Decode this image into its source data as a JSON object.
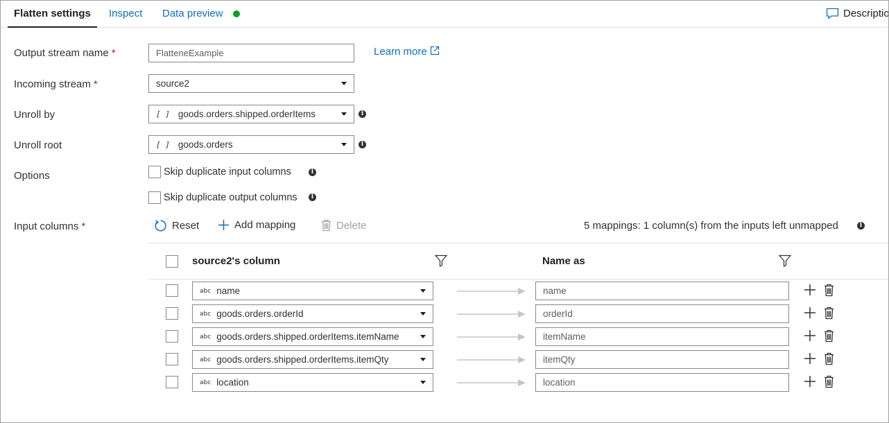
{
  "tabs": [
    {
      "label": "Flatten settings"
    },
    {
      "label": "Inspect"
    },
    {
      "label": "Data preview"
    }
  ],
  "description_label": "Description",
  "form": {
    "output_stream": {
      "label": "Output stream name",
      "required": "*",
      "value": "FlatteneExample"
    },
    "learn_more": "Learn more",
    "incoming_stream": {
      "label": "Incoming stream",
      "required": "*",
      "value": "source2"
    },
    "unroll_by": {
      "label": "Unroll by",
      "prefix": "[ ]",
      "value": "goods.orders.shipped.orderItems"
    },
    "unroll_root": {
      "label": "Unroll root",
      "prefix": "[ ]",
      "value": "goods.orders"
    },
    "options": {
      "label": "Options",
      "skip_input": "Skip duplicate input columns",
      "skip_output": "Skip duplicate output columns"
    },
    "input_columns": {
      "label": "Input columns",
      "required": "*"
    }
  },
  "toolbar": {
    "reset": "Reset",
    "add_mapping": "Add mapping",
    "delete": "Delete",
    "summary": "5 mappings: 1 column(s) from the inputs left unmapped"
  },
  "table": {
    "headers": {
      "source": "source2's column",
      "name_as": "Name as"
    },
    "type_tag": "abc",
    "rows": [
      {
        "source": "name",
        "name_as": "name"
      },
      {
        "source": "goods.orders.orderId",
        "name_as": "orderId"
      },
      {
        "source": "goods.orders.shipped.orderItems.itemName",
        "name_as": "itemName"
      },
      {
        "source": "goods.orders.shipped.orderItems.itemQty",
        "name_as": "itemQty"
      },
      {
        "source": "location",
        "name_as": "location"
      }
    ]
  },
  "colors": {
    "link": "#106ebe",
    "status_ok": "#0f9d24",
    "required": "#a4262c"
  },
  "icons": {
    "description": "comment-icon",
    "learn_more": "external-link-icon",
    "info": "info-icon",
    "reset": "refresh-icon",
    "add": "plus-icon",
    "delete": "trash-icon",
    "filter": "filter-icon",
    "dropdown": "chevron-down-icon",
    "mapping_arrow": "arrow-right-icon"
  }
}
